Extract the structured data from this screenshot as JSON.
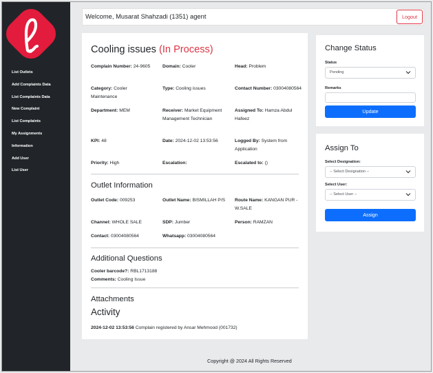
{
  "sidebar": {
    "items": [
      {
        "label": "List Outlets"
      },
      {
        "label": "Add Complaints Data"
      },
      {
        "label": "List Complaints Data"
      },
      {
        "label": "New Complaint"
      },
      {
        "label": "List Complaints"
      },
      {
        "label": "My Assignments"
      },
      {
        "label": "Information"
      },
      {
        "label": "Add User"
      },
      {
        "label": "List User"
      }
    ]
  },
  "header": {
    "welcome": "Welcome, Musarat Shahzadi (1351) agent",
    "logout_label": "Logout"
  },
  "complaint": {
    "title": "Cooling issues",
    "status": "(In Process)",
    "complain_number": {
      "label": "Complain Number:",
      "value": "24-9605"
    },
    "domain": {
      "label": "Domain:",
      "value": "Cooler"
    },
    "head": {
      "label": "Head:",
      "value": "Problem"
    },
    "category": {
      "label": "Category:",
      "value": "Cooler Maintenance"
    },
    "type": {
      "label": "Type:",
      "value": "Cooling issues"
    },
    "contact_number": {
      "label": "Contact Number:",
      "value": "03004080564"
    },
    "department": {
      "label": "Department:",
      "value": "MEM"
    },
    "receiver": {
      "label": "Receiver:",
      "value": "Market Equipment Management Technician"
    },
    "assigned_to": {
      "label": "Assigned To:",
      "value": "Hamza Abdul Hafeez"
    },
    "kpi": {
      "label": "KPI:",
      "value": "48"
    },
    "date": {
      "label": "Date:",
      "value": "2024-12-02 13:53:56"
    },
    "logged_by": {
      "label": "Logged By:",
      "value": "System from Application"
    },
    "priority": {
      "label": "Priority:",
      "value": "High"
    },
    "escalation": {
      "label": "Escalation:",
      "value": ""
    },
    "escalated_to": {
      "label": "Escalated to:",
      "value": "()"
    }
  },
  "outlet": {
    "heading": "Outlet Information",
    "outlet_code": {
      "label": "Outlet Code:",
      "value": "009253"
    },
    "outlet_name": {
      "label": "Outlet Name:",
      "value": "BISMILLAH P/S"
    },
    "route_name": {
      "label": "Route Name:",
      "value": "KANGAN PUR - W.SALE"
    },
    "channel": {
      "label": "Channel:",
      "value": "WHOLE SALE"
    },
    "sdp": {
      "label": "SDP:",
      "value": "Jumber"
    },
    "person": {
      "label": "Person:",
      "value": "RAMZAN"
    },
    "contact": {
      "label": "Contact:",
      "value": "03004080564"
    },
    "whatsapp": {
      "label": "Whatsapp:",
      "value": "03004080564"
    }
  },
  "additional": {
    "heading": "Additional Questions",
    "cooler_barcode": {
      "label": "Cooler barcode?:",
      "value": "RBL1713188"
    },
    "comments": {
      "label": "Comments:",
      "value": "Cooling Issue"
    }
  },
  "attachments": {
    "heading": "Attachments"
  },
  "activity": {
    "heading": "Activity",
    "entries": [
      {
        "time": "2024-12-02 13:53:56",
        "text": "Complain registered by Ansar Mehmood (001732)"
      }
    ]
  },
  "change_status": {
    "heading": "Change Status",
    "status_label": "Status",
    "status_value": "Pending",
    "remarks_label": "Remarks",
    "update_label": "Update"
  },
  "assign_to": {
    "heading": "Assign To",
    "designation_label": "Select Designation:",
    "designation_value": "-- Select Designation --",
    "user_label": "Select User:",
    "user_value": "-- Select User --",
    "assign_label": "Assign"
  },
  "footer": {
    "text": "Copyright @ 2024 All Rights Reserved"
  },
  "colors": {
    "sidebar": "#212529",
    "danger": "#dc3545",
    "primary": "#0d6efd",
    "logo": "#e31b3c"
  }
}
